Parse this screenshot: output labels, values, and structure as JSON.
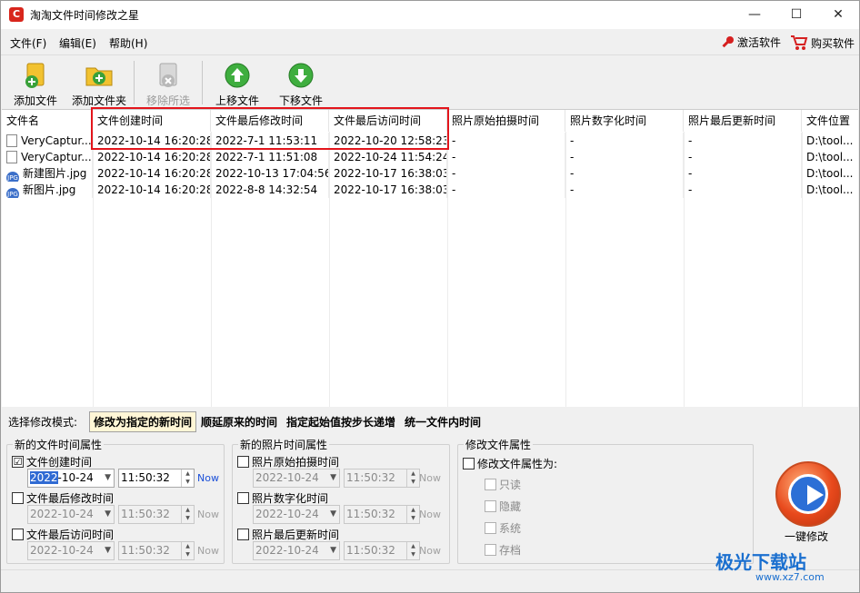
{
  "window": {
    "title": "淘淘文件时间修改之星",
    "minimize": "—",
    "maximize": "☐",
    "close": "✕"
  },
  "menu": {
    "items": [
      "文件(F)",
      "编辑(E)",
      "帮助(H)"
    ],
    "activate": "激活软件",
    "buy": "购买软件"
  },
  "toolbar": {
    "add_file": "添加文件",
    "add_folder": "添加文件夹",
    "remove": "移除所选",
    "move_up": "上移文件",
    "move_down": "下移文件"
  },
  "table": {
    "columns": [
      "文件名",
      "文件创建时间",
      "文件最后修改时间",
      "文件最后访问时间",
      "照片原始拍摄时间",
      "照片数字化时间",
      "照片最后更新时间",
      "文件位置"
    ],
    "rows": [
      {
        "icon": "file-icon",
        "cells": [
          "VeryCaptur...",
          "2022-10-14 16:20:28",
          "2022-7-1 11:53:11",
          "2022-10-20 12:58:23",
          "-",
          "-",
          "-",
          "D:\\tool..."
        ]
      },
      {
        "icon": "file-icon",
        "cells": [
          "VeryCaptur...",
          "2022-10-14 16:20:28",
          "2022-7-1 11:51:08",
          "2022-10-24 11:54:24",
          "-",
          "-",
          "-",
          "D:\\tool..."
        ]
      },
      {
        "icon": "jpg-icon",
        "cells": [
          "新建图片.jpg",
          "2022-10-14 16:20:28",
          "2022-10-13 17:04:56",
          "2022-10-17 16:38:03",
          "-",
          "-",
          "-",
          "D:\\tool..."
        ]
      },
      {
        "icon": "jpg-icon",
        "cells": [
          "新图片.jpg",
          "2022-10-14 16:20:28",
          "2022-8-8 14:32:54",
          "2022-10-17 16:38:03",
          "-",
          "-",
          "-",
          "D:\\tool..."
        ]
      }
    ]
  },
  "mode": {
    "label": "选择修改模式:",
    "options": [
      "修改为指定的新时间",
      "顺延原来的时间",
      "指定起始值按步长递增",
      "统一文件内时间"
    ],
    "active": 0
  },
  "file_group": {
    "legend": "新的文件时间属性",
    "items": [
      {
        "label": "文件创建时间",
        "checked": "☑",
        "date_prefix": "2022",
        "date_rest": "-10-24",
        "time": "11:50:32",
        "now": "Now"
      },
      {
        "label": "文件最后修改时间",
        "date": "2022-10-24",
        "time": "11:50:32",
        "now": "Now"
      },
      {
        "label": "文件最后访问时间",
        "date": "2022-10-24",
        "time": "11:50:32",
        "now": "Now"
      }
    ]
  },
  "photo_group": {
    "legend": "新的照片时间属性",
    "items": [
      {
        "label": "照片原始拍摄时间",
        "date": "2022-10-24",
        "time": "11:50:32",
        "now": "Now"
      },
      {
        "label": "照片数字化时间",
        "date": "2022-10-24",
        "time": "11:50:32",
        "now": "Now"
      },
      {
        "label": "照片最后更新时间",
        "date": "2022-10-24",
        "time": "11:50:32",
        "now": "Now"
      }
    ]
  },
  "attr_group": {
    "legend": "修改文件属性",
    "main": "修改文件属性为:",
    "items": [
      "只读",
      "隐藏",
      "系统",
      "存档"
    ]
  },
  "one_click": "一键修改",
  "watermark": {
    "brand": "极光下载站",
    "url": "www.xz7.com"
  },
  "colors": {
    "highlight_box": "#e3151c",
    "accent": "#2f6ad3"
  }
}
